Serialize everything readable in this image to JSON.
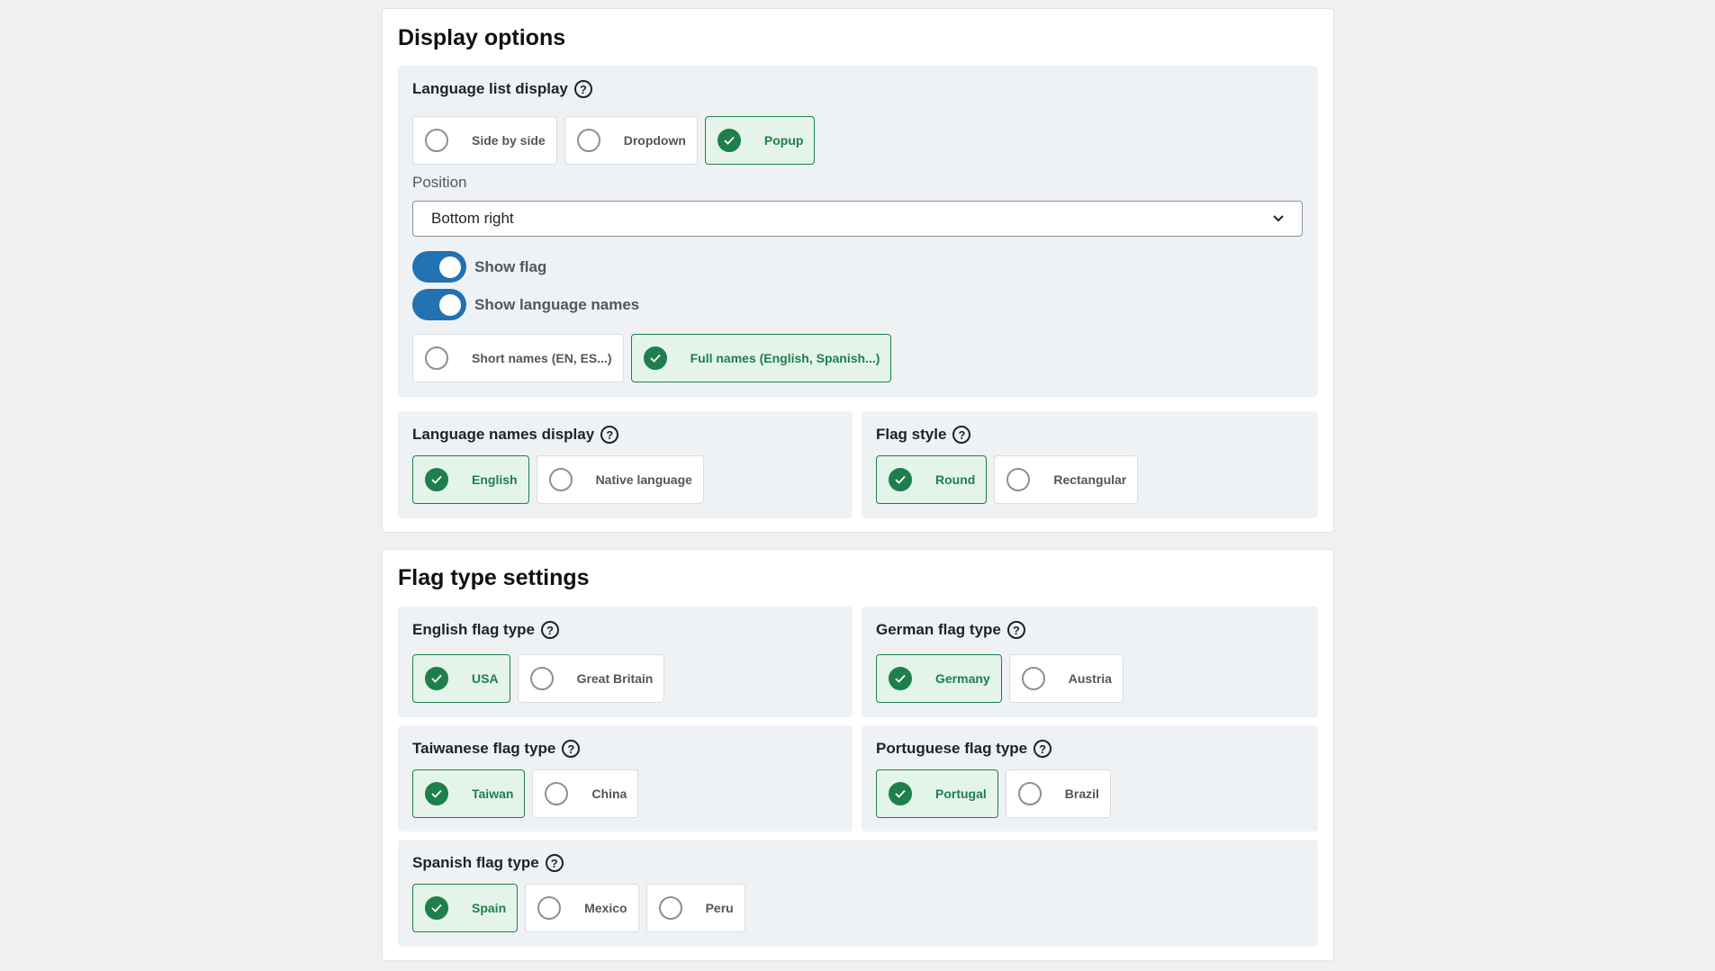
{
  "display_options": {
    "title": "Display options",
    "language_list_display": {
      "label": "Language list display",
      "options": [
        {
          "label": "Side by side",
          "selected": false
        },
        {
          "label": "Dropdown",
          "selected": false
        },
        {
          "label": "Popup",
          "selected": true
        }
      ]
    },
    "position": {
      "label": "Position",
      "value": "Bottom right"
    },
    "show_flag": {
      "label": "Show flag",
      "on": true
    },
    "show_language_names": {
      "label": "Show language names",
      "on": true
    },
    "name_format": {
      "options": [
        {
          "label": "Short names (EN, ES...)",
          "selected": false
        },
        {
          "label": "Full names (English, Spanish...)",
          "selected": true
        }
      ]
    },
    "language_names_display": {
      "label": "Language names display",
      "options": [
        {
          "label": "English",
          "selected": true
        },
        {
          "label": "Native language",
          "selected": false
        }
      ]
    },
    "flag_style": {
      "label": "Flag style",
      "options": [
        {
          "label": "Round",
          "selected": true
        },
        {
          "label": "Rectangular",
          "selected": false
        }
      ]
    }
  },
  "flag_type_settings": {
    "title": "Flag type settings",
    "english": {
      "label": "English flag type",
      "options": [
        {
          "label": "USA",
          "selected": true
        },
        {
          "label": "Great Britain",
          "selected": false
        }
      ]
    },
    "german": {
      "label": "German flag type",
      "options": [
        {
          "label": "Germany",
          "selected": true
        },
        {
          "label": "Austria",
          "selected": false
        }
      ]
    },
    "taiwanese": {
      "label": "Taiwanese flag type",
      "options": [
        {
          "label": "Taiwan",
          "selected": true
        },
        {
          "label": "China",
          "selected": false
        }
      ]
    },
    "portuguese": {
      "label": "Portuguese flag type",
      "options": [
        {
          "label": "Portugal",
          "selected": true
        },
        {
          "label": "Brazil",
          "selected": false
        }
      ]
    },
    "spanish": {
      "label": "Spanish flag type",
      "options": [
        {
          "label": "Spain",
          "selected": true
        },
        {
          "label": "Mexico",
          "selected": false
        },
        {
          "label": "Peru",
          "selected": false
        }
      ]
    }
  },
  "icons": {
    "help": "?",
    "check": "check-icon",
    "chevron": "chevron-down-icon"
  },
  "colors": {
    "accent_green": "#1f7f4c",
    "toggle_blue": "#2271b1"
  }
}
